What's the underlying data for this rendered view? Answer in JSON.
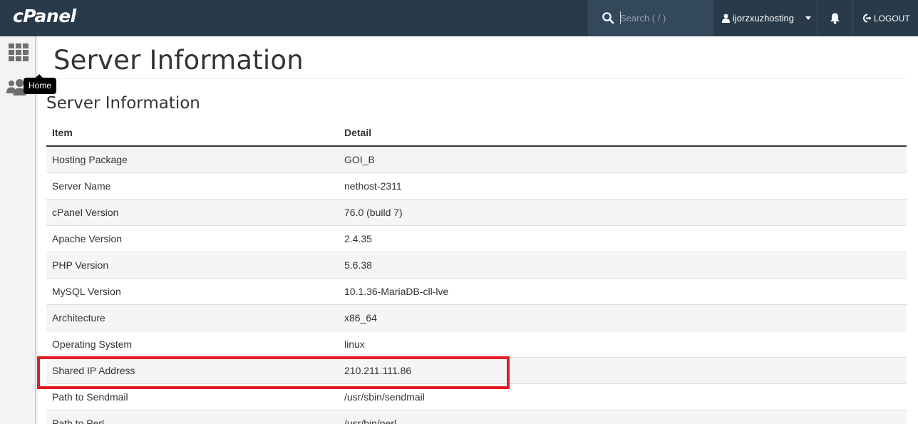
{
  "topbar": {
    "logo": "cPanel",
    "search_placeholder": "Search ( / )",
    "username": "ijorzxuzhosting",
    "logout_label": "LOGOUT"
  },
  "sidebar": {
    "tooltip": "Home",
    "items": [
      {
        "icon": "grid-icon",
        "label": "Home"
      },
      {
        "icon": "users-icon",
        "label": ""
      }
    ]
  },
  "page": {
    "title": "Server Information",
    "section_title": "Server Information"
  },
  "table": {
    "headers": [
      "Item",
      "Detail"
    ],
    "rows": [
      {
        "item": "Hosting Package",
        "detail": "GOI_B"
      },
      {
        "item": "Server Name",
        "detail": "nethost-2311"
      },
      {
        "item": "cPanel Version",
        "detail": "76.0 (build 7)"
      },
      {
        "item": "Apache Version",
        "detail": "2.4.35"
      },
      {
        "item": "PHP Version",
        "detail": "5.6.38"
      },
      {
        "item": "MySQL Version",
        "detail": "10.1.36-MariaDB-cll-lve"
      },
      {
        "item": "Architecture",
        "detail": "x86_64"
      },
      {
        "item": "Operating System",
        "detail": "linux"
      },
      {
        "item": "Shared IP Address",
        "detail": "210.211.111.86"
      },
      {
        "item": "Path to Sendmail",
        "detail": "/usr/sbin/sendmail"
      },
      {
        "item": "Path to Perl",
        "detail": "/usr/bin/perl"
      }
    ]
  },
  "colors": {
    "topbar_bg": "#293a4a",
    "highlight": "#e21b25"
  }
}
